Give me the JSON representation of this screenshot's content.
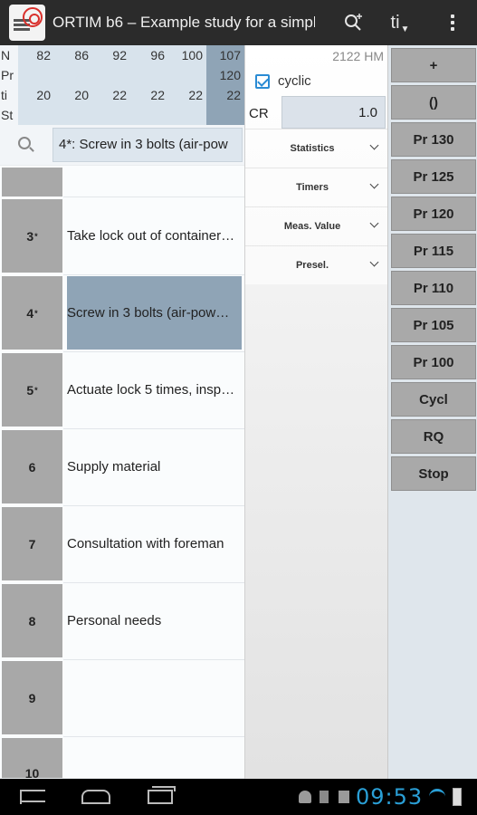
{
  "app": {
    "title": "ORTIM b6 – Example study for a simple…"
  },
  "actionbar": {
    "ti_label": "ti",
    "ti_sub": "▼"
  },
  "matrix": {
    "row_labels": [
      "N",
      "Pr",
      "ti",
      "St"
    ],
    "n_values": [
      "82",
      "86",
      "92",
      "96",
      "100",
      "107"
    ],
    "pr_values": [
      "",
      "",
      "",
      "",
      "",
      "120"
    ],
    "ti_values": [
      "20",
      "20",
      "22",
      "22",
      "22",
      "22"
    ]
  },
  "search": {
    "value": "4*: Screw in 3 bolts (air-pow"
  },
  "tasks": [
    {
      "num": "",
      "star": "",
      "desc": ""
    },
    {
      "num": "3",
      "star": "*",
      "desc": "Take lock out of container…"
    },
    {
      "num": "4",
      "star": "*",
      "desc": "Screw in 3 bolts (air-pow…"
    },
    {
      "num": "5",
      "star": "*",
      "desc": "Actuate lock 5 times, insp…"
    },
    {
      "num": "6",
      "star": "",
      "desc": "Supply material"
    },
    {
      "num": "7",
      "star": "",
      "desc": "Consultation with foreman"
    },
    {
      "num": "8",
      "star": "",
      "desc": "Personal needs"
    },
    {
      "num": "9",
      "star": "",
      "desc": ""
    },
    {
      "num": "10",
      "star": "",
      "desc": ""
    }
  ],
  "middle": {
    "hm": "2122 HM",
    "cyclic_label": "cyclic",
    "cyclic_checked": true,
    "cr_label": "CR",
    "cr_value": "1.0",
    "dropdowns": [
      "Statistics",
      "Timers",
      "Meas. Value",
      "Presel."
    ]
  },
  "right_buttons": [
    "+",
    "()",
    "Pr 130",
    "Pr 125",
    "Pr 120",
    "Pr 115",
    "Pr 110",
    "Pr 105",
    "Pr 100",
    "Cycl",
    "RQ",
    "Stop"
  ],
  "statusbar": {
    "clock": "09:53"
  },
  "colors": {
    "accent": "#2a9fd6",
    "selected_row": "#8fa4b6",
    "button_gray": "#a9a9a9"
  }
}
